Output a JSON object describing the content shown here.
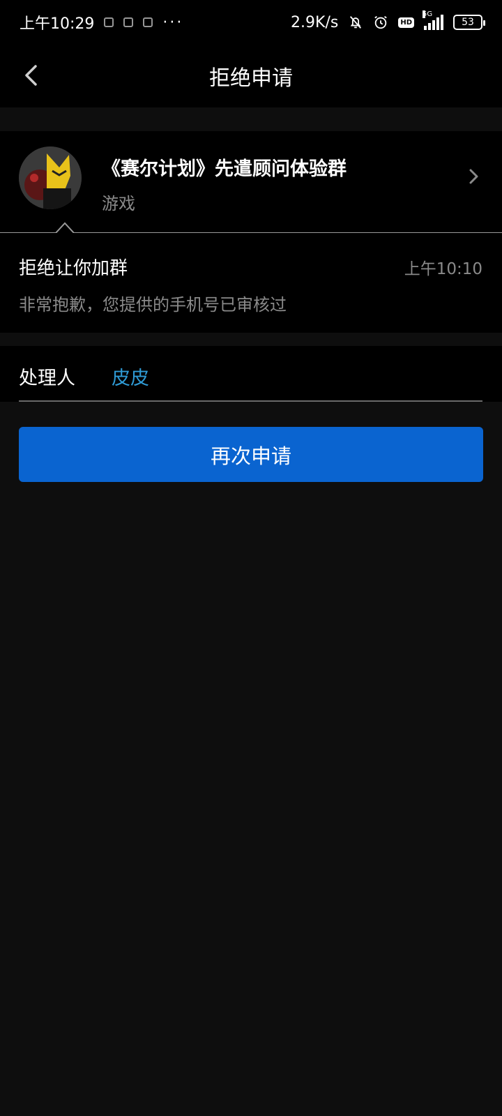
{
  "status_bar": {
    "time": "上午10:29",
    "dots": "···",
    "net_speed": "2.9K/s",
    "hd": "HD",
    "network": "5G",
    "battery": "53"
  },
  "header": {
    "title": "拒绝申请"
  },
  "group": {
    "name": "《赛尔计划》先遣顾问体验群",
    "category": "游戏"
  },
  "rejection": {
    "title": "拒绝让你加群",
    "time": "上午10:10",
    "reason": "非常抱歉，您提供的手机号已审核过"
  },
  "handler": {
    "label": "处理人",
    "name": "皮皮"
  },
  "actions": {
    "reapply_label": "再次申请"
  },
  "colors": {
    "accent_button": "#0a64d0",
    "handler_link": "#2f9bd6",
    "secondary_text": "#8a8a8a"
  }
}
